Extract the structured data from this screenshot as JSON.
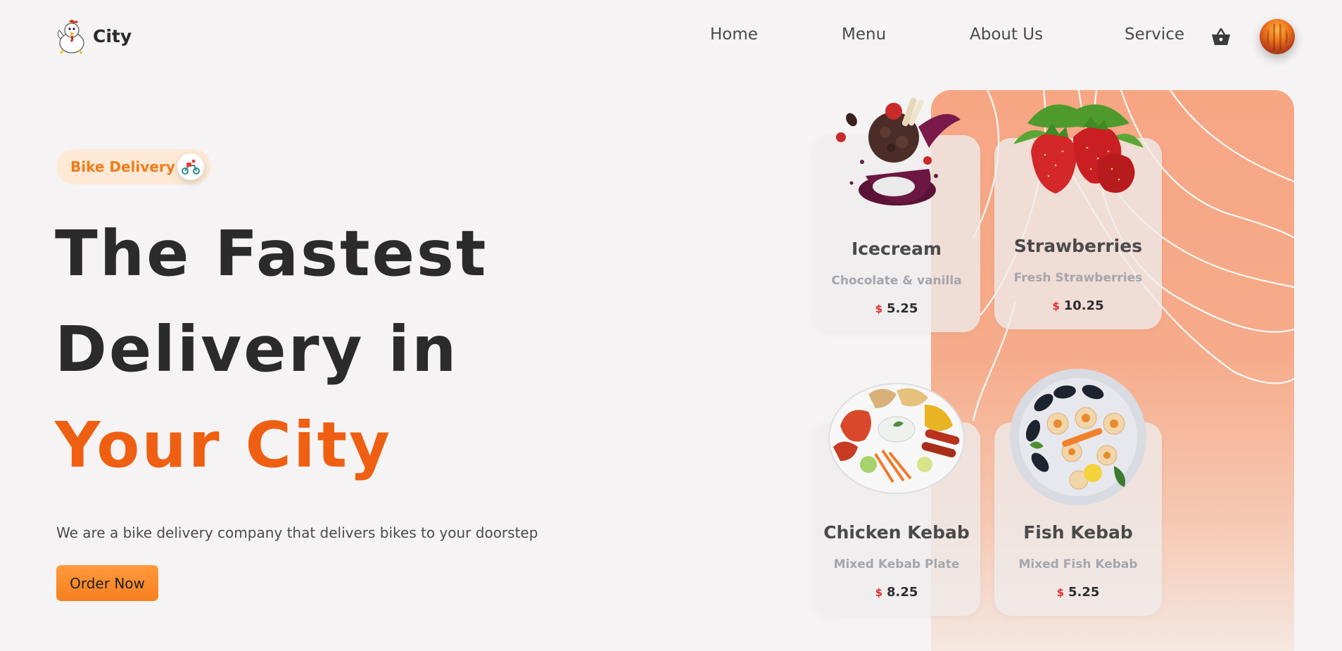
{
  "brand": {
    "name": "City",
    "logo_icon": "chicken-mascot-icon"
  },
  "nav": {
    "items": [
      "Home",
      "Menu",
      "About Us",
      "Service"
    ]
  },
  "header_icons": {
    "cart": "basket-icon",
    "avatar": "user-avatar"
  },
  "hero": {
    "badge": {
      "label": "Bike Delivery",
      "icon": "delivery-scooter-icon"
    },
    "title_line1": "The Fastest",
    "title_line2": "Delivery in",
    "title_line3": "Your City",
    "subtitle": "We are a bike delivery company that delivers bikes to your doorstep",
    "cta_label": "Order Now"
  },
  "items": [
    {
      "name": "Icecream",
      "desc": "Chocolate & vanilla",
      "currency": "$",
      "price": "5.25",
      "image": "icecream-image"
    },
    {
      "name": "Strawberries",
      "desc": "Fresh Strawberries",
      "currency": "$",
      "price": "10.25",
      "image": "strawberries-image"
    },
    {
      "name": "Chicken Kebab",
      "desc": "Mixed Kebab Plate",
      "currency": "$",
      "price": "8.25",
      "image": "chicken-kebab-image"
    },
    {
      "name": "Fish Kebab",
      "desc": "Mixed Fish Kebab",
      "currency": "$",
      "price": "5.25",
      "image": "fish-kebab-image"
    }
  ],
  "colors": {
    "accent": "#ef5f12",
    "button": "#f77f1f",
    "badge_bg": "#fde9d6",
    "panel": "#f7a684",
    "price_currency": "#e02d2d"
  }
}
